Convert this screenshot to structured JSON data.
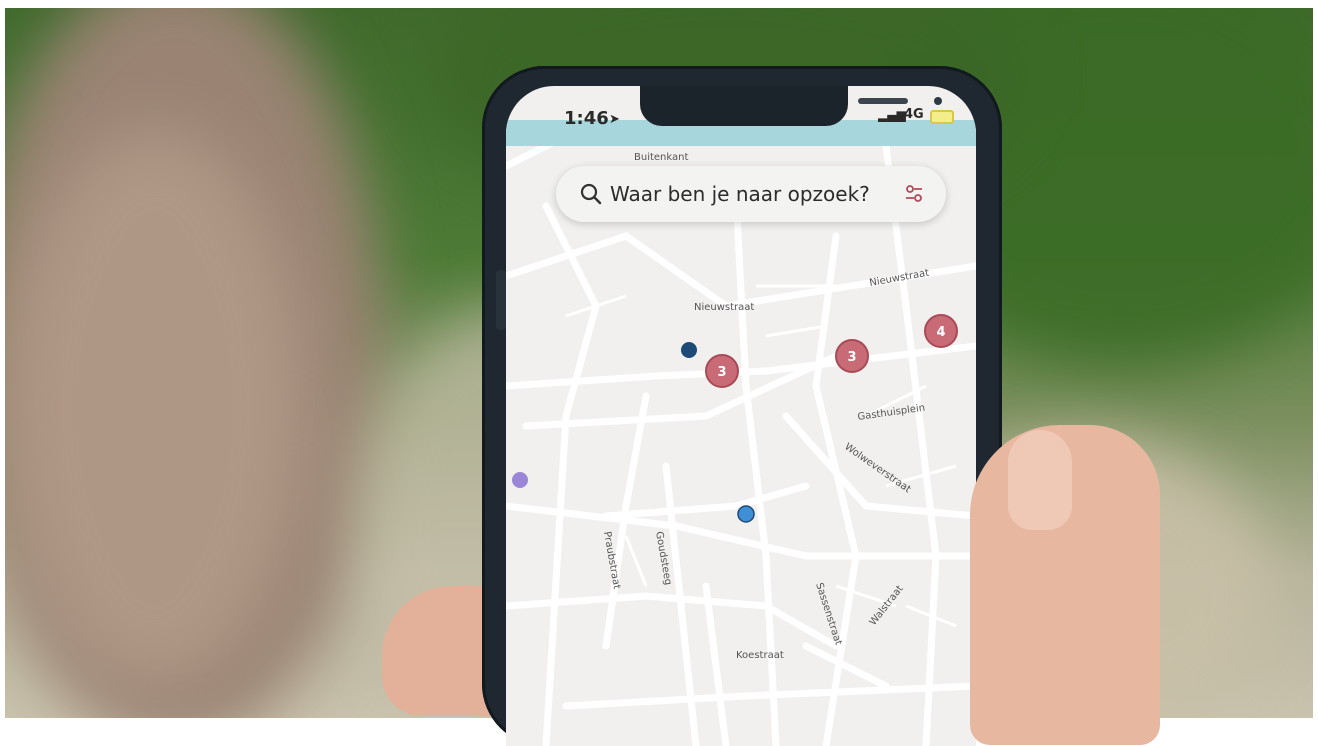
{
  "status_bar": {
    "time": "1:46",
    "network": "4G"
  },
  "search": {
    "placeholder": "Waar ben je naar opzoek?"
  },
  "streets": {
    "buitenkant": "Buitenkant",
    "nieuwstraat_1": "Nieuwstraat",
    "nieuwstraat_2": "Nieuwstraat",
    "gasthuisplein": "Gasthuisplein",
    "wolweverstraat": "Wolweverstraat",
    "sassenstraat": "Sassenstraat",
    "walstraat": "Walstraat",
    "koestraat": "Koestraat",
    "praubstraat": "Praubstraat",
    "goudsteeg": "Goudsteeg"
  },
  "clusters": [
    {
      "count": "3"
    },
    {
      "count": "3"
    },
    {
      "count": "4"
    }
  ],
  "colors": {
    "cluster": "#c96b76",
    "pin_dark": "#1e4a78",
    "pin_light": "#3f8fd6",
    "pin_purple": "#9b85d6"
  }
}
